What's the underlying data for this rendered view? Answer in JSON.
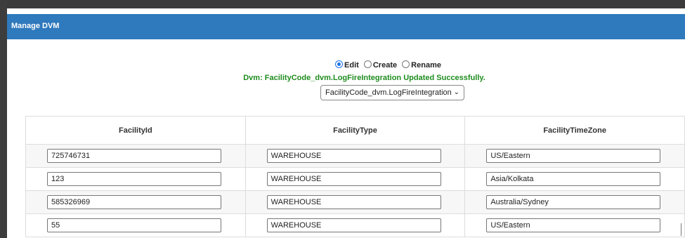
{
  "header": {
    "title": "Manage DVM"
  },
  "mode": {
    "options": [
      {
        "label": "Edit",
        "selected": true
      },
      {
        "label": "Create",
        "selected": false
      },
      {
        "label": "Rename",
        "selected": false
      }
    ]
  },
  "status_message": "Dvm: FacilityCode_dvm.LogFireIntegration Updated Successfully.",
  "dvm_select": {
    "value": "FacilityCode_dvm.LogFireIntegration"
  },
  "table": {
    "columns": [
      "FacilityId",
      "FacilityType",
      "FacilityTimeZone"
    ],
    "rows": [
      [
        "725746731",
        "WAREHOUSE",
        "US/Eastern"
      ],
      [
        "123",
        "WAREHOUSE",
        "Asia/Kolkata"
      ],
      [
        "585326969",
        "WAREHOUSE",
        "Australia/Sydney"
      ],
      [
        "55",
        "WAREHOUSE",
        "US/Eastern"
      ]
    ]
  },
  "colors": {
    "header_bg": "#2f79bd",
    "success_text": "#1f8c1f",
    "radio_selected": "#1a73e8"
  }
}
